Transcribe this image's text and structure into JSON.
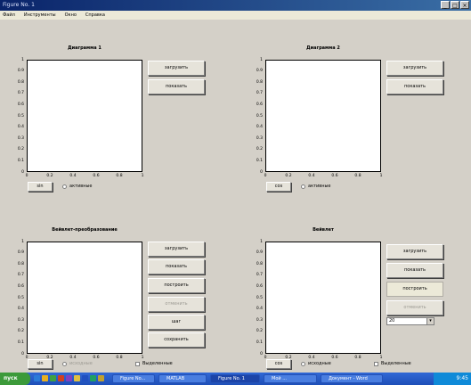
{
  "window": {
    "title": "Figure No. 1",
    "controls": [
      "_",
      "□",
      "×"
    ]
  },
  "menu": {
    "items": [
      "Файл",
      "Инструменты",
      "Окно",
      "Справка"
    ]
  },
  "panels": [
    {
      "title": "Диаграмма 1",
      "yticks": [
        "1",
        "0.9",
        "0.8",
        "0.7",
        "0.6",
        "0.5",
        "0.4",
        "0.3",
        "0.2",
        "0.1",
        "0"
      ],
      "xticks": [
        "0",
        "0.2",
        "0.4",
        "0.6",
        "0.8",
        "1"
      ],
      "buttons": [
        {
          "label": "загрузить",
          "state": "normal"
        },
        {
          "label": "показать",
          "state": "normal"
        }
      ],
      "small_button": "sin",
      "radio": {
        "label": "активные",
        "disabled": false
      },
      "checkbox": null,
      "dropdown": null
    },
    {
      "title": "Диаграмма 2",
      "yticks": [
        "1",
        "0.9",
        "0.8",
        "0.7",
        "0.6",
        "0.5",
        "0.4",
        "0.3",
        "0.2",
        "0.1",
        "0"
      ],
      "xticks": [
        "0",
        "0.2",
        "0.4",
        "0.6",
        "0.8",
        "1"
      ],
      "buttons": [
        {
          "label": "загрузить",
          "state": "normal"
        },
        {
          "label": "показать",
          "state": "normal"
        }
      ],
      "small_button": "cos",
      "radio": {
        "label": "активные",
        "disabled": false
      },
      "checkbox": null,
      "dropdown": null
    },
    {
      "title": "Вейвлет-преобразование",
      "yticks": [
        "1",
        "0.9",
        "0.8",
        "0.7",
        "0.6",
        "0.5",
        "0.4",
        "0.3",
        "0.2",
        "0.1",
        "0"
      ],
      "xticks": [
        "0",
        "0.2",
        "0.4",
        "0.6",
        "0.8",
        "1"
      ],
      "buttons": [
        {
          "label": "загрузить",
          "state": "normal"
        },
        {
          "label": "показать",
          "state": "normal"
        },
        {
          "label": "построить",
          "state": "normal"
        },
        {
          "label": "отменить",
          "state": "disabled"
        },
        {
          "label": "шаг",
          "state": "normal"
        },
        {
          "label": "сохранить",
          "state": "normal"
        }
      ],
      "small_button": "sin",
      "radio": {
        "label": "исходные",
        "disabled": true
      },
      "checkbox": {
        "label": "Выделенные"
      },
      "dropdown": null
    },
    {
      "title": "Вейвлет",
      "yticks": [
        "1",
        "0.9",
        "0.8",
        "0.7",
        "0.6",
        "0.5",
        "0.4",
        "0.3",
        "0.2",
        "0.1",
        "0"
      ],
      "xticks": [
        "0",
        "0.2",
        "0.4",
        "0.6",
        "0.8",
        "1"
      ],
      "buttons": [
        {
          "label": "загрузить",
          "state": "normal"
        },
        {
          "label": "показать",
          "state": "normal"
        },
        {
          "label": "построить",
          "state": "pressed"
        },
        {
          "label": "отменить",
          "state": "disabled"
        }
      ],
      "small_button": "cos",
      "radio": {
        "label": "исходные",
        "disabled": false
      },
      "checkbox": {
        "label": "Выделенные"
      },
      "dropdown": {
        "value": "20"
      }
    }
  ],
  "taskbar": {
    "start_label": "пуск",
    "quicklaunch_icons": [
      "ie-icon",
      "outlook-icon",
      "desktop-icon",
      "matlab-icon",
      "media-icon",
      "folder-icon",
      "word-icon",
      "excel-icon",
      "explorer-icon"
    ],
    "tasks": [
      {
        "label": "Figure No...",
        "active": false
      },
      {
        "label": "MATLAB",
        "active": false
      },
      {
        "label": "Figure No. 1",
        "active": true
      },
      {
        "label": "Мой ...",
        "active": false
      },
      {
        "label": "Документ - Word",
        "active": false
      }
    ],
    "clock": "9:45"
  }
}
